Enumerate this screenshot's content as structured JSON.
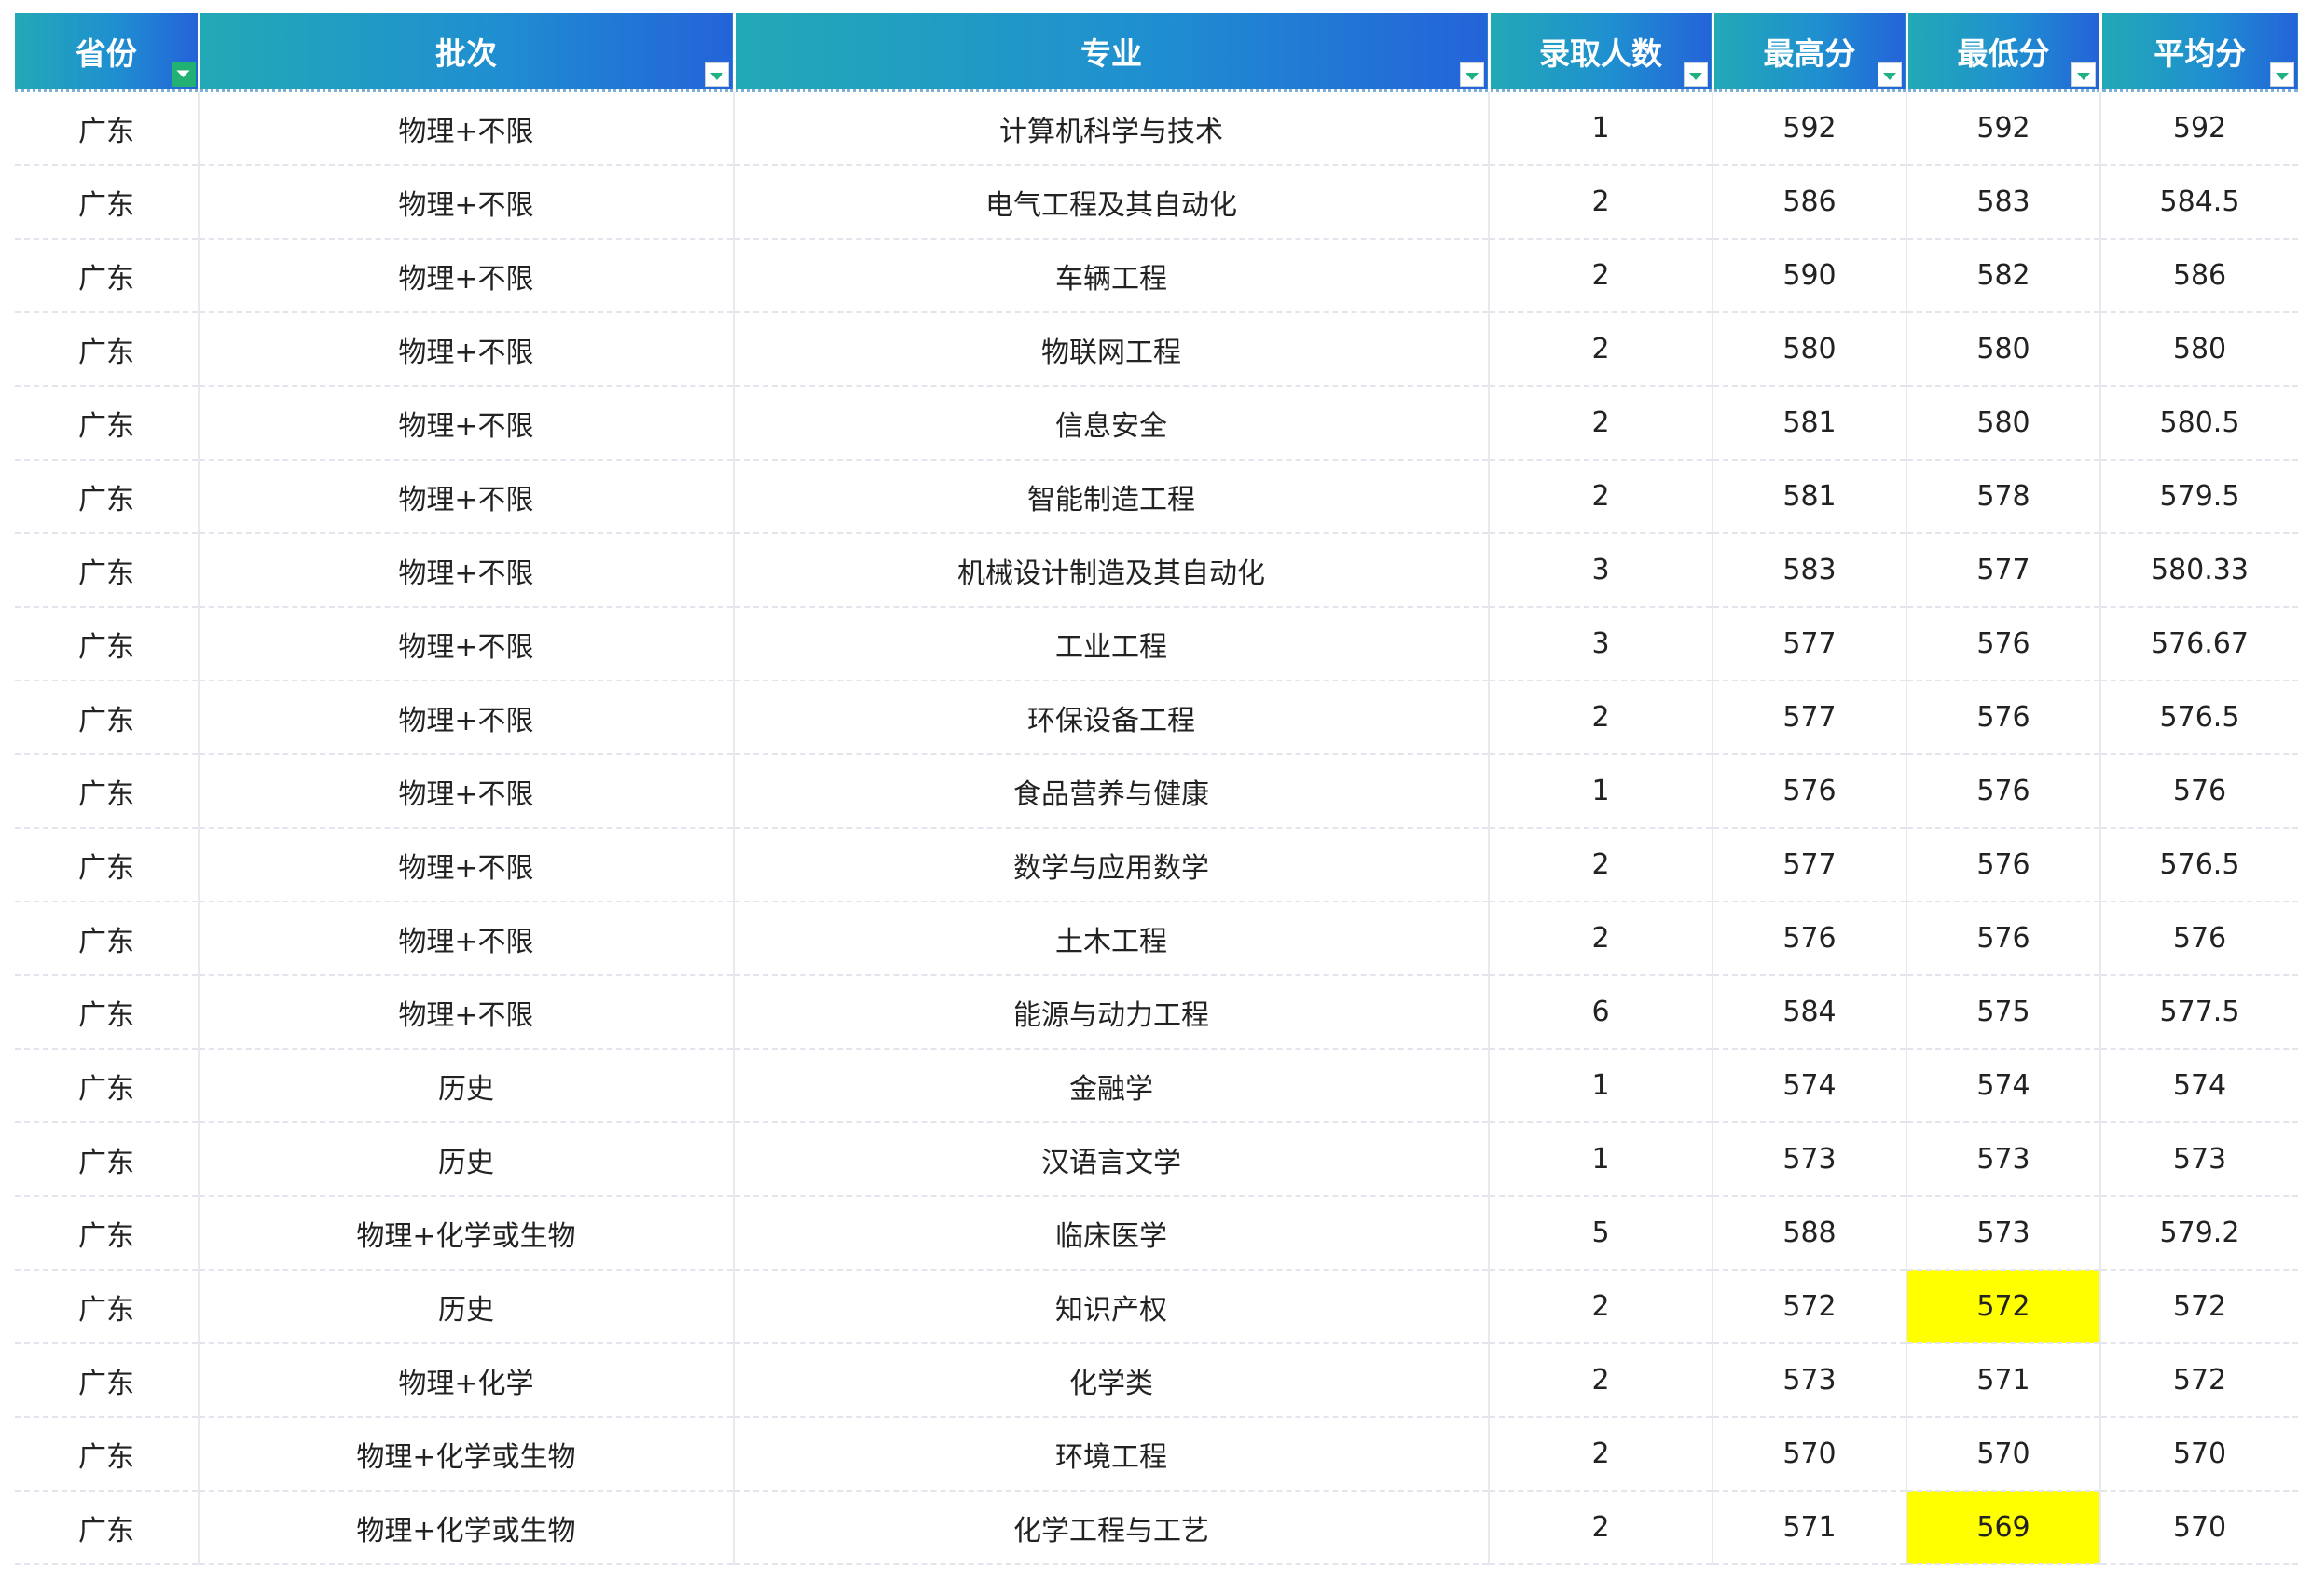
{
  "table": {
    "headers": [
      "省份",
      "批次",
      "专业",
      "录取人数",
      "最高分",
      "最低分",
      "平均分"
    ],
    "rows": [
      {
        "province": "广东",
        "batch": "物理+不限",
        "major": "计算机科学与技术",
        "count": "1",
        "max": "592",
        "min": "592",
        "avg": "592"
      },
      {
        "province": "广东",
        "batch": "物理+不限",
        "major": "电气工程及其自动化",
        "count": "2",
        "max": "586",
        "min": "583",
        "avg": "584.5"
      },
      {
        "province": "广东",
        "batch": "物理+不限",
        "major": "车辆工程",
        "count": "2",
        "max": "590",
        "min": "582",
        "avg": "586"
      },
      {
        "province": "广东",
        "batch": "物理+不限",
        "major": "物联网工程",
        "count": "2",
        "max": "580",
        "min": "580",
        "avg": "580"
      },
      {
        "province": "广东",
        "batch": "物理+不限",
        "major": "信息安全",
        "count": "2",
        "max": "581",
        "min": "580",
        "avg": "580.5"
      },
      {
        "province": "广东",
        "batch": "物理+不限",
        "major": "智能制造工程",
        "count": "2",
        "max": "581",
        "min": "578",
        "avg": "579.5"
      },
      {
        "province": "广东",
        "batch": "物理+不限",
        "major": "机械设计制造及其自动化",
        "count": "3",
        "max": "583",
        "min": "577",
        "avg": "580.33"
      },
      {
        "province": "广东",
        "batch": "物理+不限",
        "major": "工业工程",
        "count": "3",
        "max": "577",
        "min": "576",
        "avg": "576.67"
      },
      {
        "province": "广东",
        "batch": "物理+不限",
        "major": "环保设备工程",
        "count": "2",
        "max": "577",
        "min": "576",
        "avg": "576.5"
      },
      {
        "province": "广东",
        "batch": "物理+不限",
        "major": "食品营养与健康",
        "count": "1",
        "max": "576",
        "min": "576",
        "avg": "576"
      },
      {
        "province": "广东",
        "batch": "物理+不限",
        "major": "数学与应用数学",
        "count": "2",
        "max": "577",
        "min": "576",
        "avg": "576.5"
      },
      {
        "province": "广东",
        "batch": "物理+不限",
        "major": "土木工程",
        "count": "2",
        "max": "576",
        "min": "576",
        "avg": "576"
      },
      {
        "province": "广东",
        "batch": "物理+不限",
        "major": "能源与动力工程",
        "count": "6",
        "max": "584",
        "min": "575",
        "avg": "577.5"
      },
      {
        "province": "广东",
        "batch": "历史",
        "major": "金融学",
        "count": "1",
        "max": "574",
        "min": "574",
        "avg": "574"
      },
      {
        "province": "广东",
        "batch": "历史",
        "major": "汉语言文学",
        "count": "1",
        "max": "573",
        "min": "573",
        "avg": "573"
      },
      {
        "province": "广东",
        "batch": "物理+化学或生物",
        "major": "临床医学",
        "count": "5",
        "max": "588",
        "min": "573",
        "avg": "579.2"
      },
      {
        "province": "广东",
        "batch": "历史",
        "major": "知识产权",
        "count": "2",
        "max": "572",
        "min": "572",
        "avg": "572",
        "highlight_min": true
      },
      {
        "province": "广东",
        "batch": "物理+化学",
        "major": "化学类",
        "count": "2",
        "max": "573",
        "min": "571",
        "avg": "572"
      },
      {
        "province": "广东",
        "batch": "物理+化学或生物",
        "major": "环境工程",
        "count": "2",
        "max": "570",
        "min": "570",
        "avg": "570"
      },
      {
        "province": "广东",
        "batch": "物理+化学或生物",
        "major": "化学工程与工艺",
        "count": "2",
        "max": "571",
        "min": "569",
        "avg": "570",
        "highlight_min": true
      }
    ]
  },
  "colors": {
    "header_gradient_start": "#22a9b6",
    "header_gradient_end": "#2463d9",
    "highlight": "#ffff00",
    "filter_arrow": "#1fb184"
  },
  "icons": {
    "active_filter": "funnel-icon",
    "dropdown": "chevron-down-icon"
  }
}
